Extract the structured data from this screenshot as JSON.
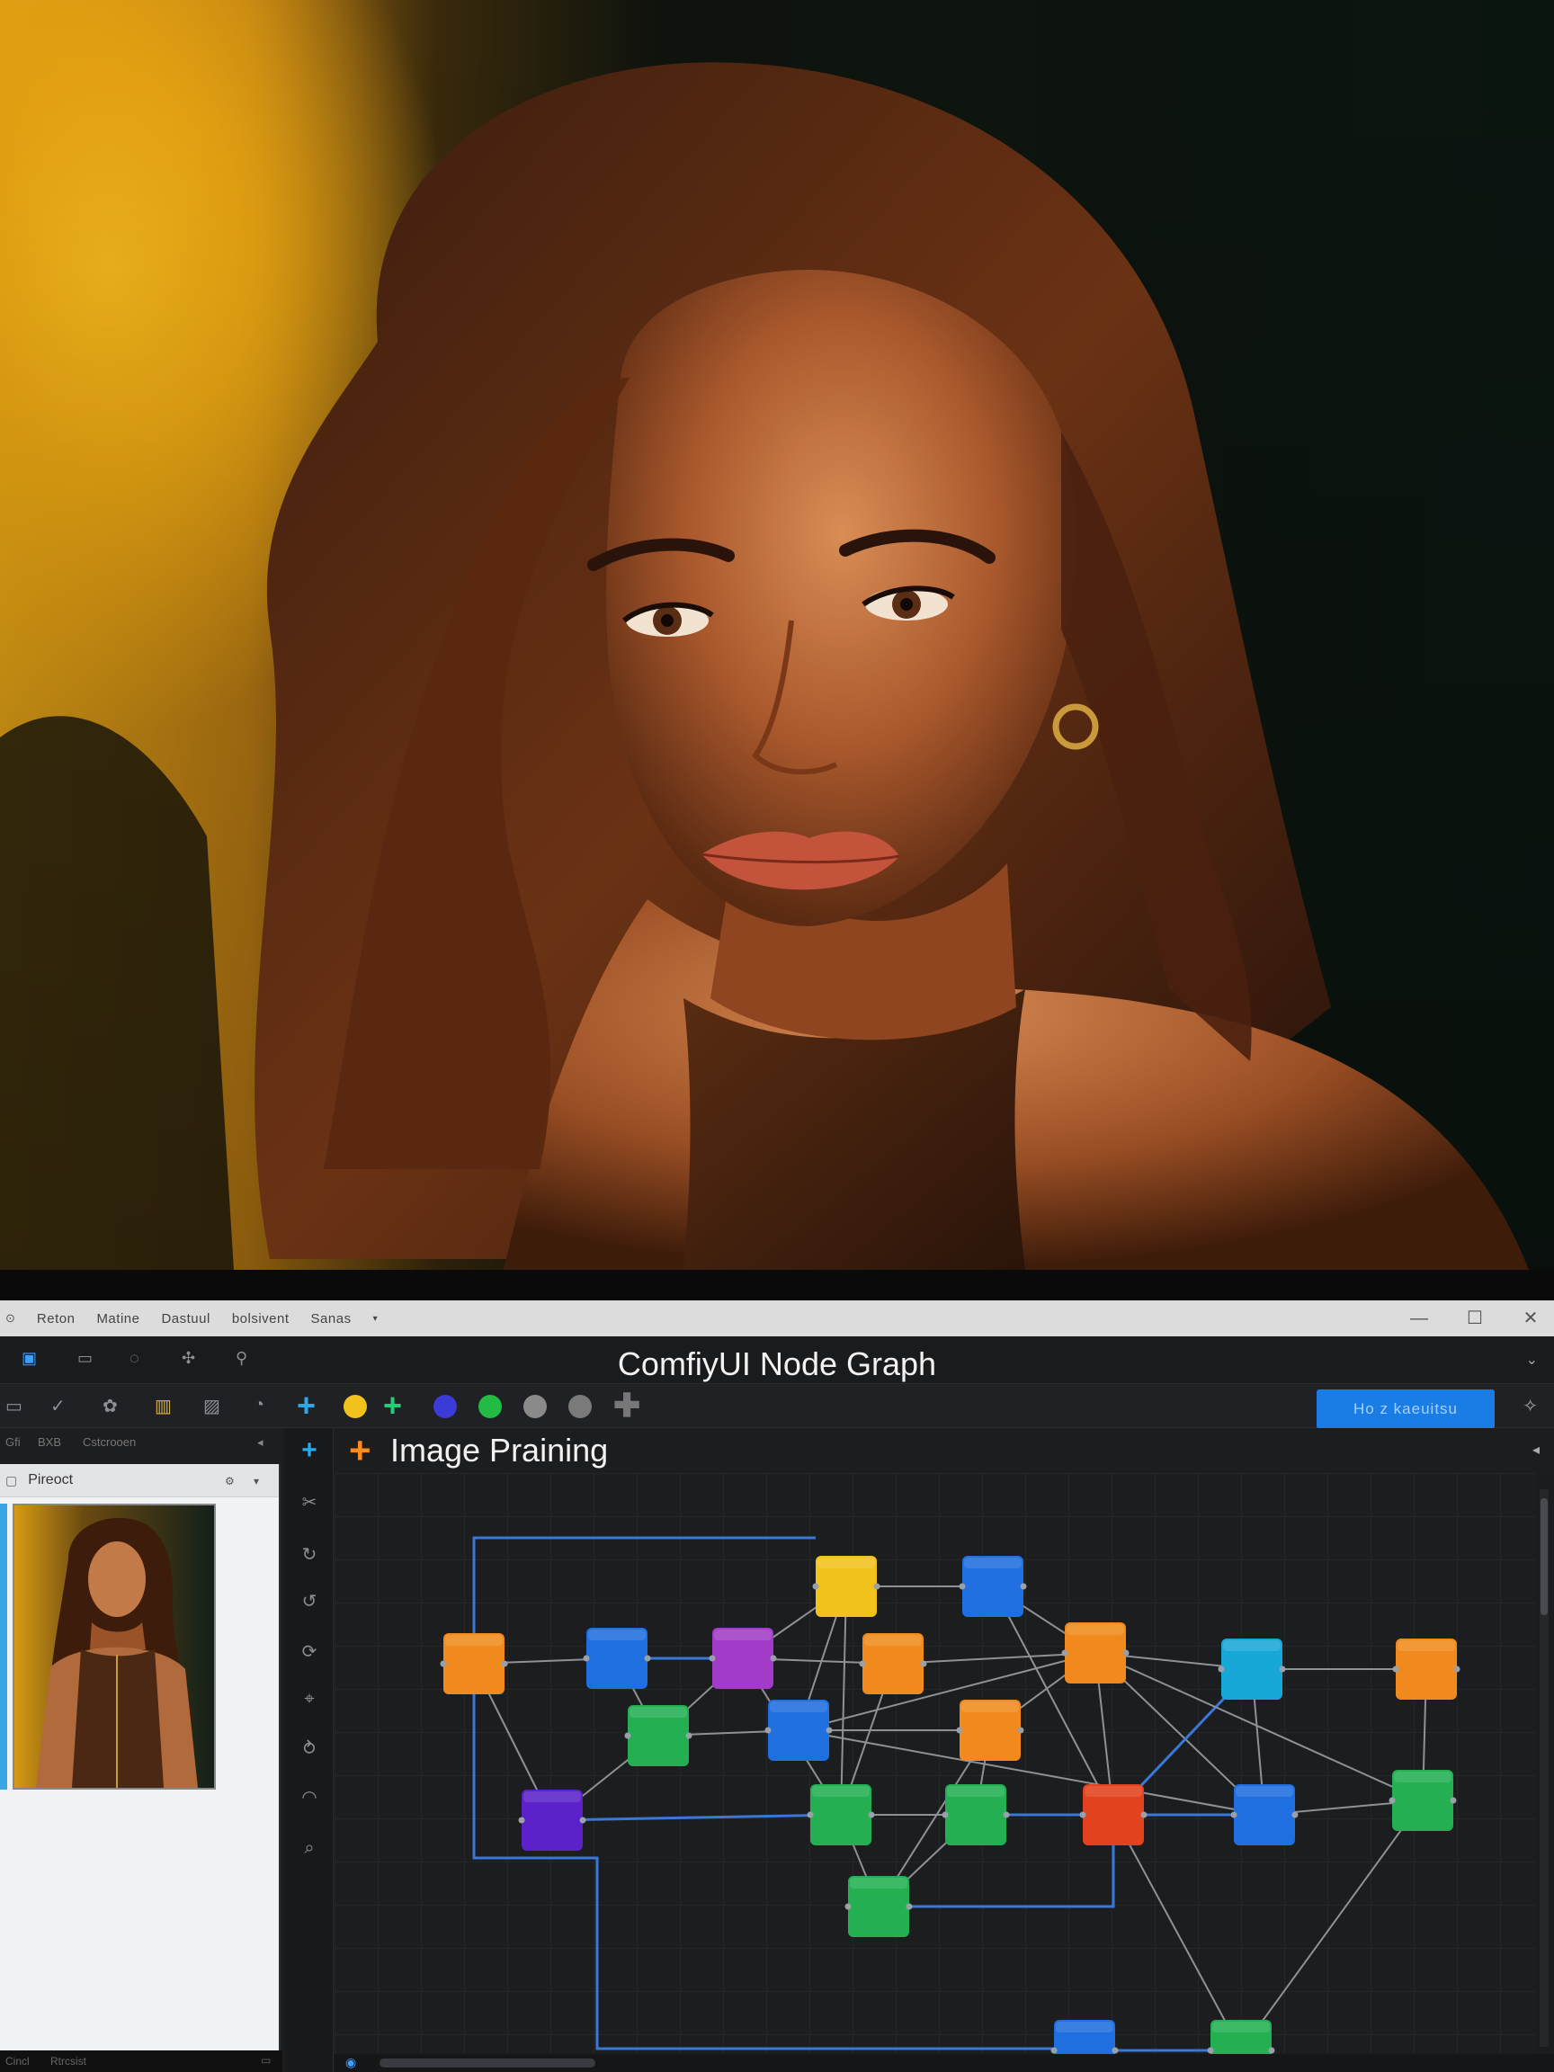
{
  "menubar": {
    "items": [
      "Reton",
      "Matine",
      "Dastuul",
      "bolsivent",
      "Sanas"
    ],
    "window_controls": {
      "minimize": "—",
      "maximize": "☐",
      "close": "✕"
    }
  },
  "titlebar": {
    "title": "ComfiyUI Node Graph"
  },
  "toolbar": {
    "run_label": "Ho z kaeuitsu",
    "palette": [
      "#2aa8ee",
      "#f2c21c",
      "#1fd07a",
      "#3b3bd8",
      "#22bb44",
      "#8a8a8a",
      "#7a7a7a",
      "#6a6a6a"
    ]
  },
  "preview": {
    "tabs": [
      "Gfi",
      "BXB",
      "Cstcrooen"
    ],
    "title": "Pireoct",
    "status_labels": [
      "Cincl",
      "Rtrcsist"
    ]
  },
  "canvas": {
    "graph_title": "Image Praining"
  },
  "graph": {
    "nodes": [
      {
        "id": "n1",
        "color": "#f08a1c"
      },
      {
        "id": "n2",
        "color": "#1f6fe0"
      },
      {
        "id": "n3",
        "color": "#a23cc8"
      },
      {
        "id": "n4",
        "color": "#f2c21c"
      },
      {
        "id": "n5",
        "color": "#1f6fe0"
      },
      {
        "id": "n6",
        "color": "#f08a1c"
      },
      {
        "id": "n7",
        "color": "#f08a1c"
      },
      {
        "id": "n8",
        "color": "#18a8d8"
      },
      {
        "id": "n9",
        "color": "#f08a1c"
      },
      {
        "id": "n10",
        "color": "#24b052"
      },
      {
        "id": "n11",
        "color": "#1f6fe0"
      },
      {
        "id": "n12",
        "color": "#f08a1c"
      },
      {
        "id": "n13",
        "color": "#5a22c8"
      },
      {
        "id": "n14",
        "color": "#24b052"
      },
      {
        "id": "n15",
        "color": "#24b052"
      },
      {
        "id": "n16",
        "color": "#e2431e"
      },
      {
        "id": "n17",
        "color": "#1f6fe0"
      },
      {
        "id": "n18",
        "color": "#24b052"
      },
      {
        "id": "n19",
        "color": "#24b052"
      },
      {
        "id": "n20",
        "color": "#1f6fe0"
      },
      {
        "id": "n21",
        "color": "#24b052"
      }
    ]
  }
}
